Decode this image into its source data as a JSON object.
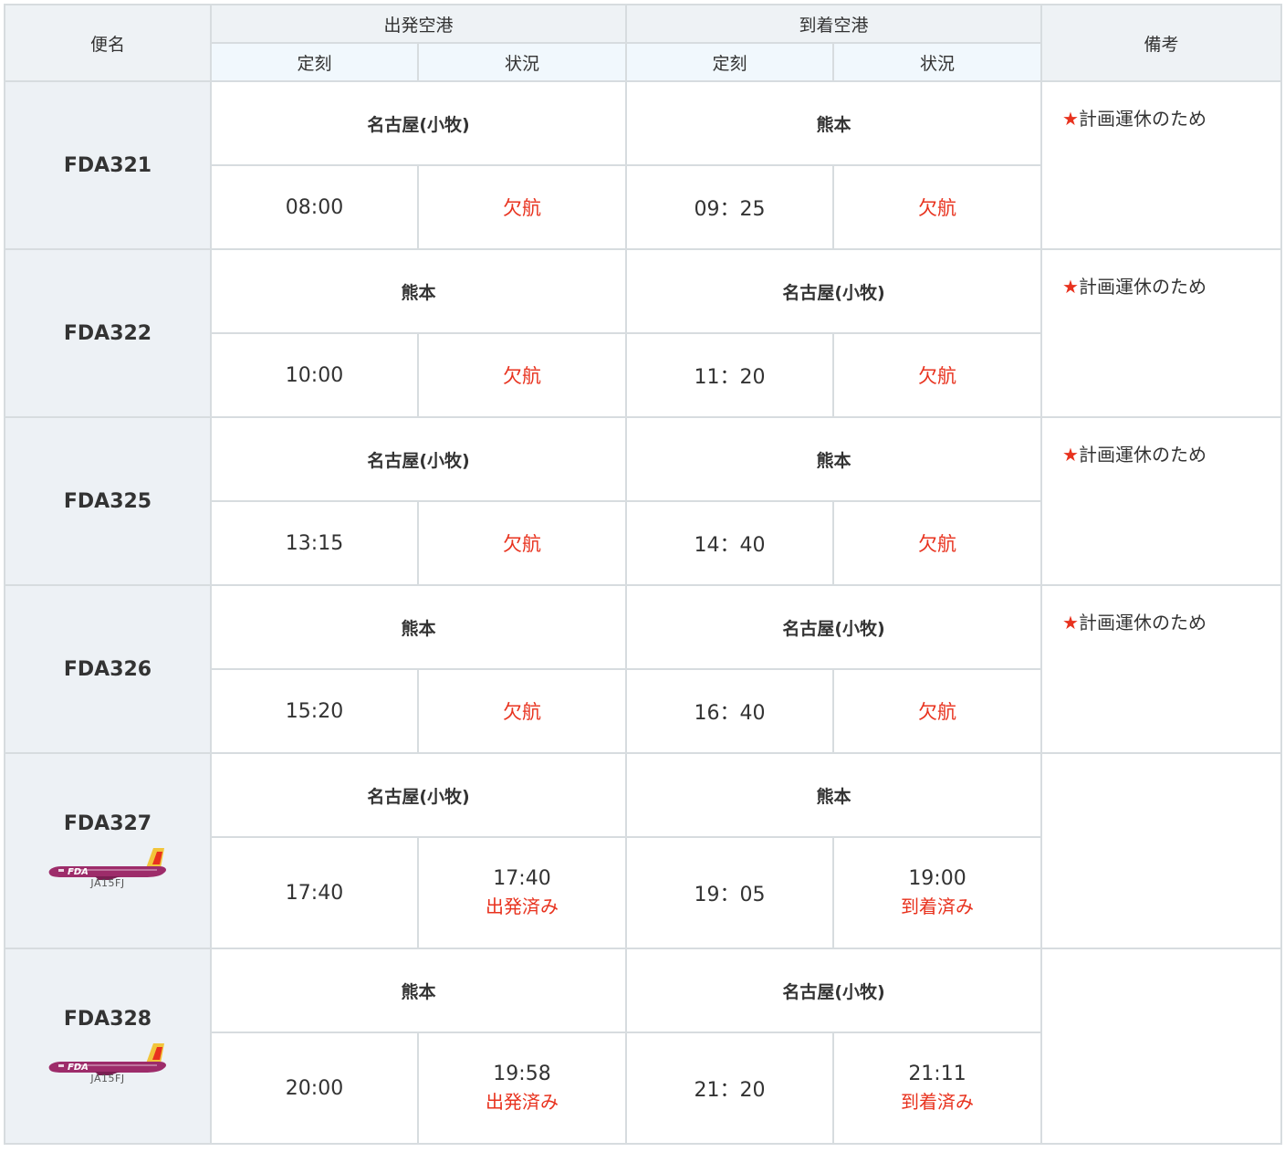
{
  "header": {
    "flight": "便名",
    "departure": "出発空港",
    "arrival": "到着空港",
    "remarks": "備考",
    "scheduled": "定刻",
    "status": "状況"
  },
  "icons": {
    "star": "★",
    "plane": "plane-icon"
  },
  "colors": {
    "status_red": "#e8321e",
    "plane_purple": "#9d2c6a",
    "header_bg": "#eef2f5",
    "subheader_bg": "#f1f8fd"
  },
  "flights": [
    {
      "number": "FDA321",
      "dep_airport": "名古屋(小牧)",
      "arr_airport": "熊本",
      "dep_time": "08:00",
      "dep_status": "欠航",
      "arr_time": "09：25",
      "arr_status": "欠航",
      "remark": "計画運休のため"
    },
    {
      "number": "FDA322",
      "dep_airport": "熊本",
      "arr_airport": "名古屋(小牧)",
      "dep_time": "10:00",
      "dep_status": "欠航",
      "arr_time": "11：20",
      "arr_status": "欠航",
      "remark": "計画運休のため"
    },
    {
      "number": "FDA325",
      "dep_airport": "名古屋(小牧)",
      "arr_airport": "熊本",
      "dep_time": "13:15",
      "dep_status": "欠航",
      "arr_time": "14：40",
      "arr_status": "欠航",
      "remark": "計画運休のため"
    },
    {
      "number": "FDA326",
      "dep_airport": "熊本",
      "arr_airport": "名古屋(小牧)",
      "dep_time": "15:20",
      "dep_status": "欠航",
      "arr_time": "16：40",
      "arr_status": "欠航",
      "remark": "計画運休のため"
    },
    {
      "number": "FDA327",
      "registration": "JA15FJ",
      "dep_airport": "名古屋(小牧)",
      "arr_airport": "熊本",
      "dep_time": "17:40",
      "dep_actual": "17:40",
      "dep_status": "出発済み",
      "arr_time": "19：05",
      "arr_actual": "19:00",
      "arr_status": "到着済み",
      "remark": ""
    },
    {
      "number": "FDA328",
      "registration": "JA15FJ",
      "dep_airport": "熊本",
      "arr_airport": "名古屋(小牧)",
      "dep_time": "20:00",
      "dep_actual": "19:58",
      "dep_status": "出発済み",
      "arr_time": "21：20",
      "arr_actual": "21:11",
      "arr_status": "到着済み",
      "remark": ""
    }
  ]
}
